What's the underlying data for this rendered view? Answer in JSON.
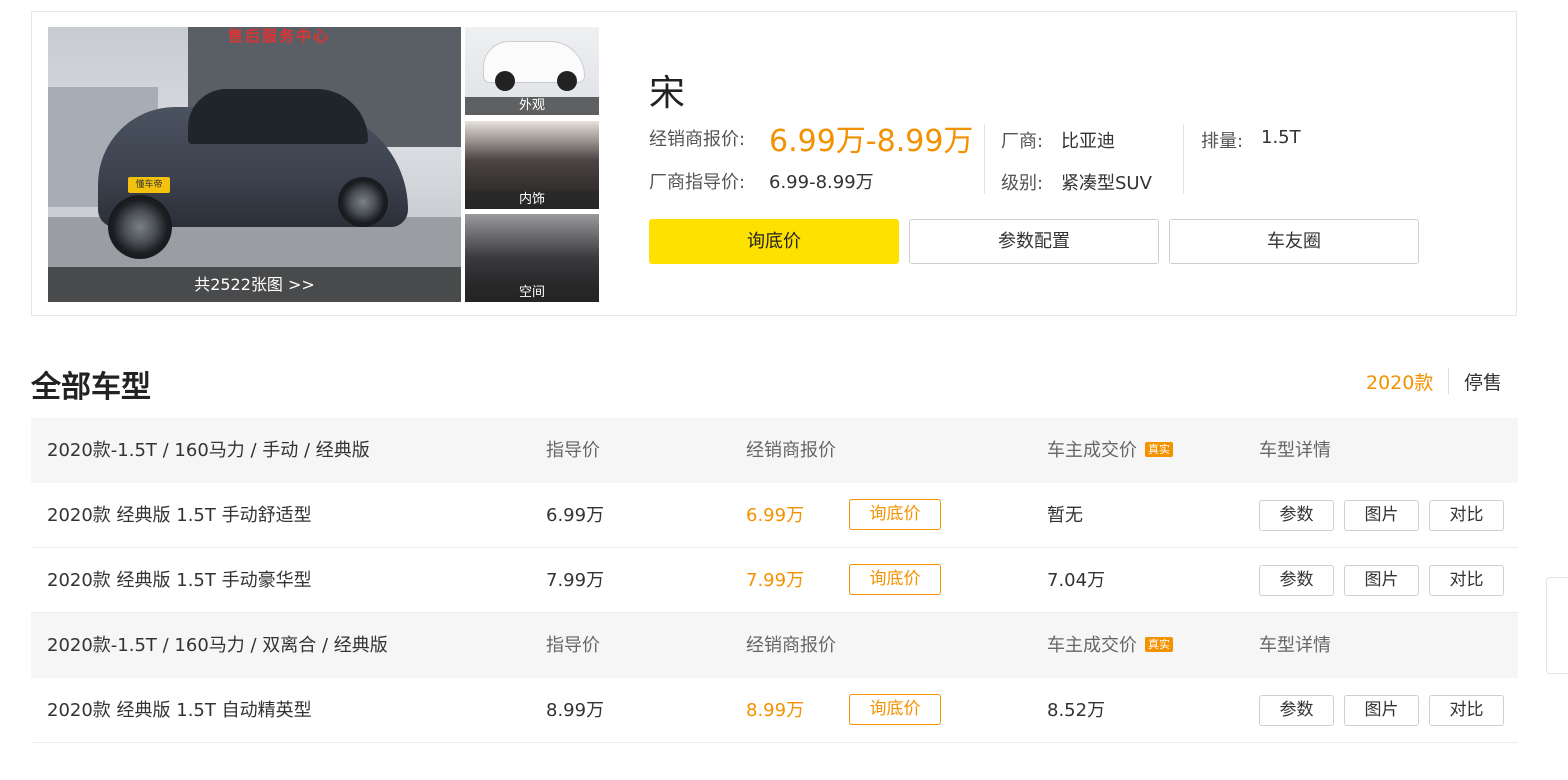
{
  "car": {
    "name": "宋",
    "dealer_price_label": "经销商报价:",
    "dealer_price": "6.99万-8.99万",
    "guide_price_label": "厂商指导价:",
    "guide_price": "6.99-8.99万",
    "maker_label": "厂商:",
    "maker": "比亚迪",
    "level_label": "级别:",
    "level": "紧凑型SUV",
    "displacement_label": "排量:",
    "displacement": "1.5T"
  },
  "gallery": {
    "showroom_sign": "售后服务中心",
    "badge": "懂车帝",
    "main_caption": "共2522张图 >>",
    "thumbs": [
      {
        "label": "外观",
        "icon": "exterior-photo"
      },
      {
        "label": "内饰",
        "icon": "interior-photo"
      },
      {
        "label": "空间",
        "icon": "seat-space-photo"
      }
    ]
  },
  "actions": {
    "inquiry": "询底价",
    "params": "参数配置",
    "community": "车友圈"
  },
  "section": {
    "title": "全部车型",
    "tab_active": "2020款",
    "tab_other": "停售"
  },
  "table": {
    "groups": [
      {
        "name": "2020款-1.5T / 160马力 / 手动 / 经典版",
        "col_guide": "指导价",
        "col_dealer": "经销商报价",
        "col_owner": "车主成交价",
        "badge": "真实",
        "col_detail": "车型详情",
        "rows": [
          {
            "name": "2020款 经典版 1.5T 手动舒适型",
            "guide": "6.99万",
            "dealer": "6.99万",
            "inquiry": "询底价",
            "owner": "暂无",
            "b1": "参数",
            "b2": "图片",
            "b3": "对比"
          },
          {
            "name": "2020款 经典版 1.5T 手动豪华型",
            "guide": "7.99万",
            "dealer": "7.99万",
            "inquiry": "询底价",
            "owner": "7.04万",
            "b1": "参数",
            "b2": "图片",
            "b3": "对比"
          }
        ]
      },
      {
        "name": "2020款-1.5T / 160马力 / 双离合 / 经典版",
        "col_guide": "指导价",
        "col_dealer": "经销商报价",
        "col_owner": "车主成交价",
        "badge": "真实",
        "col_detail": "车型详情",
        "rows": [
          {
            "name": "2020款 经典版 1.5T 自动精英型",
            "guide": "8.99万",
            "dealer": "8.99万",
            "inquiry": "询底价",
            "owner": "8.52万",
            "b1": "参数",
            "b2": "图片",
            "b3": "对比"
          }
        ]
      }
    ]
  },
  "colors": {
    "accent": "#f39200",
    "primary_button": "#ffe100"
  }
}
